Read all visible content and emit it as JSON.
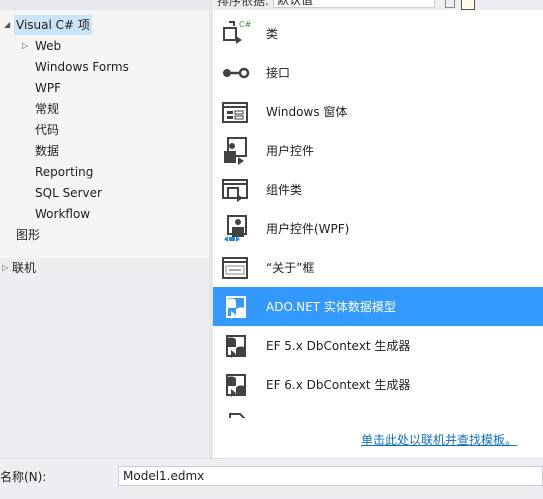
{
  "tree": {
    "nodes": [
      {
        "label": "Visual C# 项",
        "expanded": true,
        "selected": true
      },
      {
        "label": "Web",
        "collapsed": true
      },
      {
        "label": "Windows Forms"
      },
      {
        "label": "WPF"
      },
      {
        "label": "常规"
      },
      {
        "label": "代码"
      },
      {
        "label": "数据"
      },
      {
        "label": "Reporting"
      },
      {
        "label": "SQL Server"
      },
      {
        "label": "Workflow"
      },
      {
        "label": "图形"
      }
    ],
    "online": {
      "label": "联机"
    }
  },
  "sortbar": {
    "label": "排序依据:",
    "value": "默认值"
  },
  "templates": [
    {
      "label": "类",
      "icon": "class-icon"
    },
    {
      "label": "接口",
      "icon": "interface-icon"
    },
    {
      "label": "Windows 窗体",
      "icon": "windows-form-icon"
    },
    {
      "label": "用户控件",
      "icon": "user-control-icon"
    },
    {
      "label": "组件类",
      "icon": "component-class-icon"
    },
    {
      "label": "用户控件(WPF)",
      "icon": "wpf-user-control-icon"
    },
    {
      "label": "“关于”框",
      "icon": "about-box-icon"
    },
    {
      "label": "ADO.NET 实体数据模型",
      "icon": "entity-data-model-icon",
      "selected": true
    },
    {
      "label": "EF 5.x DbContext 生成器",
      "icon": "ef-generator-icon"
    },
    {
      "label": "EF 6.x DbContext 生成器",
      "icon": "ef-generator-icon"
    }
  ],
  "online_link": "单击此处以联机并查找模板。",
  "name_field": {
    "label": "名称(N):",
    "value": "Model1.edmx"
  },
  "colors": {
    "selected_item": "#3399ff",
    "tree_selected": "#cce4f7",
    "link": "#0e70c0"
  }
}
